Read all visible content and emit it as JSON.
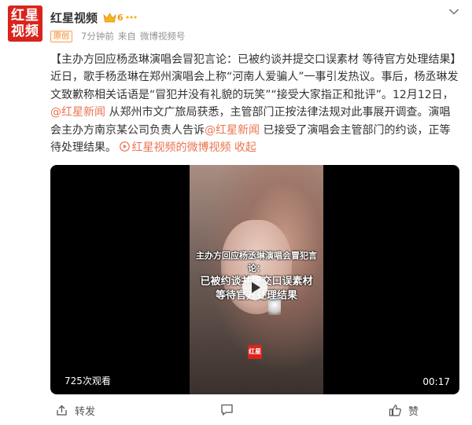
{
  "header": {
    "avatar_text_top": "红星",
    "avatar_text_bottom": "视频",
    "user_name": "红星视频",
    "vip_level": "6",
    "orig_tag": "原创",
    "time": "7分钟前",
    "source_prefix": "来自",
    "source": "微博视频号"
  },
  "post": {
    "seg1": "【主办方回应杨丞琳演唱会冒犯言论：已被约谈并提交口误素材 等待官方处理结果】近日，歌手杨丞琳在郑州演唱会上称“河南人爱骗人”一事引发热议。事后，杨丞琳发文致歉称相关话语是“冒犯并没有礼貌的玩笑”“接受大家指正和批评”。12月12日，",
    "mention1": "@红星新闻",
    "seg2": " 从郑州市文广旅局获悉，主管部门正按法律法规对此事展开调查。演唱会主办方南京某公司负责人告诉",
    "mention2": "@红星新闻",
    "seg3": " 已接受了演唱会主管部门的约谈，正等待处理结果。",
    "video_link": "红星视频的微博视频",
    "collapse": "收起"
  },
  "video": {
    "caption_line1": "主办方回应杨丞琳演唱会冒犯言论：",
    "caption_line2": "已被约谈并提交口误素材",
    "caption_line3": "等待官方处理结果",
    "logo_text": "红星",
    "views": "725次观看",
    "duration": "00:17"
  },
  "actions": {
    "forward": "转发",
    "comment": "",
    "like": "赞"
  },
  "colors": {
    "brand_red": "#d9241c",
    "link": "#eb7350",
    "orig_tag": "#f08a2b",
    "vip_gold": "#f29b14"
  },
  "icons": [
    "crown-icon",
    "more-icon",
    "chevron-down-icon",
    "video-link-icon",
    "play-icon",
    "forward-icon",
    "comment-icon",
    "like-icon"
  ]
}
